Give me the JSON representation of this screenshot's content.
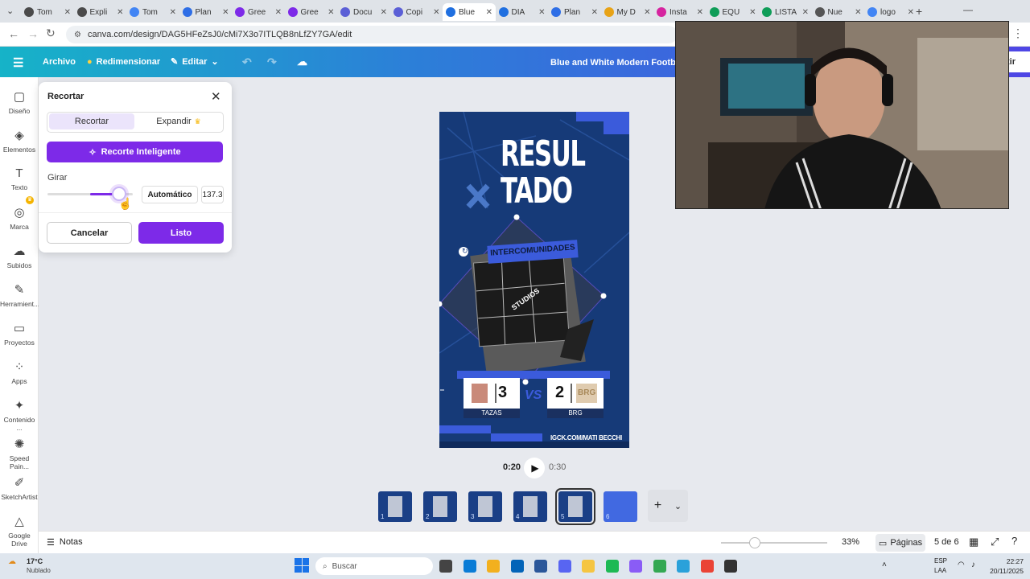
{
  "browser": {
    "tabs": [
      {
        "label": "Tom",
        "color": "#4a4a4a"
      },
      {
        "label": "Expli",
        "color": "#4a4a4a"
      },
      {
        "label": "Tom",
        "color": "#4285f4"
      },
      {
        "label": "Plan",
        "color": "#2e6ee6"
      },
      {
        "label": "Gree",
        "color": "#7d2ae8"
      },
      {
        "label": "Gree",
        "color": "#7d2ae8"
      },
      {
        "label": "Docu",
        "color": "#5b5fd6"
      },
      {
        "label": "Copi",
        "color": "#5b5fd6"
      },
      {
        "label": "Blue",
        "color": "#1f6fe0",
        "active": true
      },
      {
        "label": "DIA",
        "color": "#1f6fe0"
      },
      {
        "label": "Plan",
        "color": "#2e6ee6"
      },
      {
        "label": "My D",
        "color": "#e8a317"
      },
      {
        "label": "Insta",
        "color": "#d6249f"
      },
      {
        "label": "EQU",
        "color": "#0f9d58"
      },
      {
        "label": "LISTA",
        "color": "#0f9d58"
      },
      {
        "label": "Nue",
        "color": "#555555"
      },
      {
        "label": "logo",
        "color": "#4285f4"
      }
    ],
    "url": "canva.com/design/DAG5HFeZsJ0/cMi7X3o7ITLQB8nLfZY7GA/edit"
  },
  "header": {
    "archivo": "Archivo",
    "redimensionar": "Redimensionar",
    "editar": "Editar",
    "design_title": "Blue and White Modern Football M",
    "share_partial": "tir"
  },
  "rail": [
    {
      "label": "Diseño",
      "icon": "layout-icon"
    },
    {
      "label": "Elementos",
      "icon": "shapes-icon"
    },
    {
      "label": "Texto",
      "icon": "text-icon"
    },
    {
      "label": "Marca",
      "icon": "brand-icon"
    },
    {
      "label": "Subidos",
      "icon": "cloud-upload-icon"
    },
    {
      "label": "Herramient...",
      "icon": "pen-icon"
    },
    {
      "label": "Proyectos",
      "icon": "folder-icon"
    },
    {
      "label": "Apps",
      "icon": "apps-icon"
    },
    {
      "label": "Contenido ...",
      "icon": "magic-content-icon"
    },
    {
      "label": "Speed Pain...",
      "icon": "speed-paint-icon"
    },
    {
      "label": "SketchArtist",
      "icon": "sketch-artist-icon"
    },
    {
      "label": "Google Drive",
      "icon": "google-drive-icon"
    }
  ],
  "crop_panel": {
    "title": "Recortar",
    "tab_crop": "Recortar",
    "tab_expand": "Expandir",
    "smart_crop": "Recorte Inteligente",
    "rotate_label": "Girar",
    "rotate_fraction": 0.84,
    "auto_button": "Automático",
    "rotate_value": "137.3",
    "cancel": "Cancelar",
    "done": "Listo"
  },
  "poster": {
    "title_line1": "RESUL",
    "title_line2": "TADO",
    "banner": "INTERCOMUNIDADES",
    "logo_text": "STUDIOS",
    "team_left_score": "3",
    "team_left_name": "TAZAS",
    "vs": "VS",
    "team_right_score": "2",
    "team_right_name": "BRG",
    "team_right_badge": "BRG",
    "footer": "IGCK.COM/MATI BECCHI"
  },
  "playback": {
    "current": "0:20",
    "total": "0:30"
  },
  "pages": {
    "count_label": "5 de 6",
    "pages_label": "Páginas",
    "zoom": "33%",
    "zoom_fraction": 0.32,
    "notes": "Notas",
    "thumb_numbers": [
      "1",
      "2",
      "3",
      "4",
      "5",
      "6"
    ],
    "active_page": 5
  },
  "taskbar": {
    "weather_temp": "17°C",
    "weather_desc": "Nublado",
    "search_placeholder": "Buscar",
    "lang": "ESP",
    "lang2": "LAA",
    "time": "22:27",
    "date": "20/11/2025"
  },
  "colors": {
    "accent": "#7d2ae8",
    "poster_bg": "#163a78",
    "poster_accent": "#3b5bdb"
  }
}
